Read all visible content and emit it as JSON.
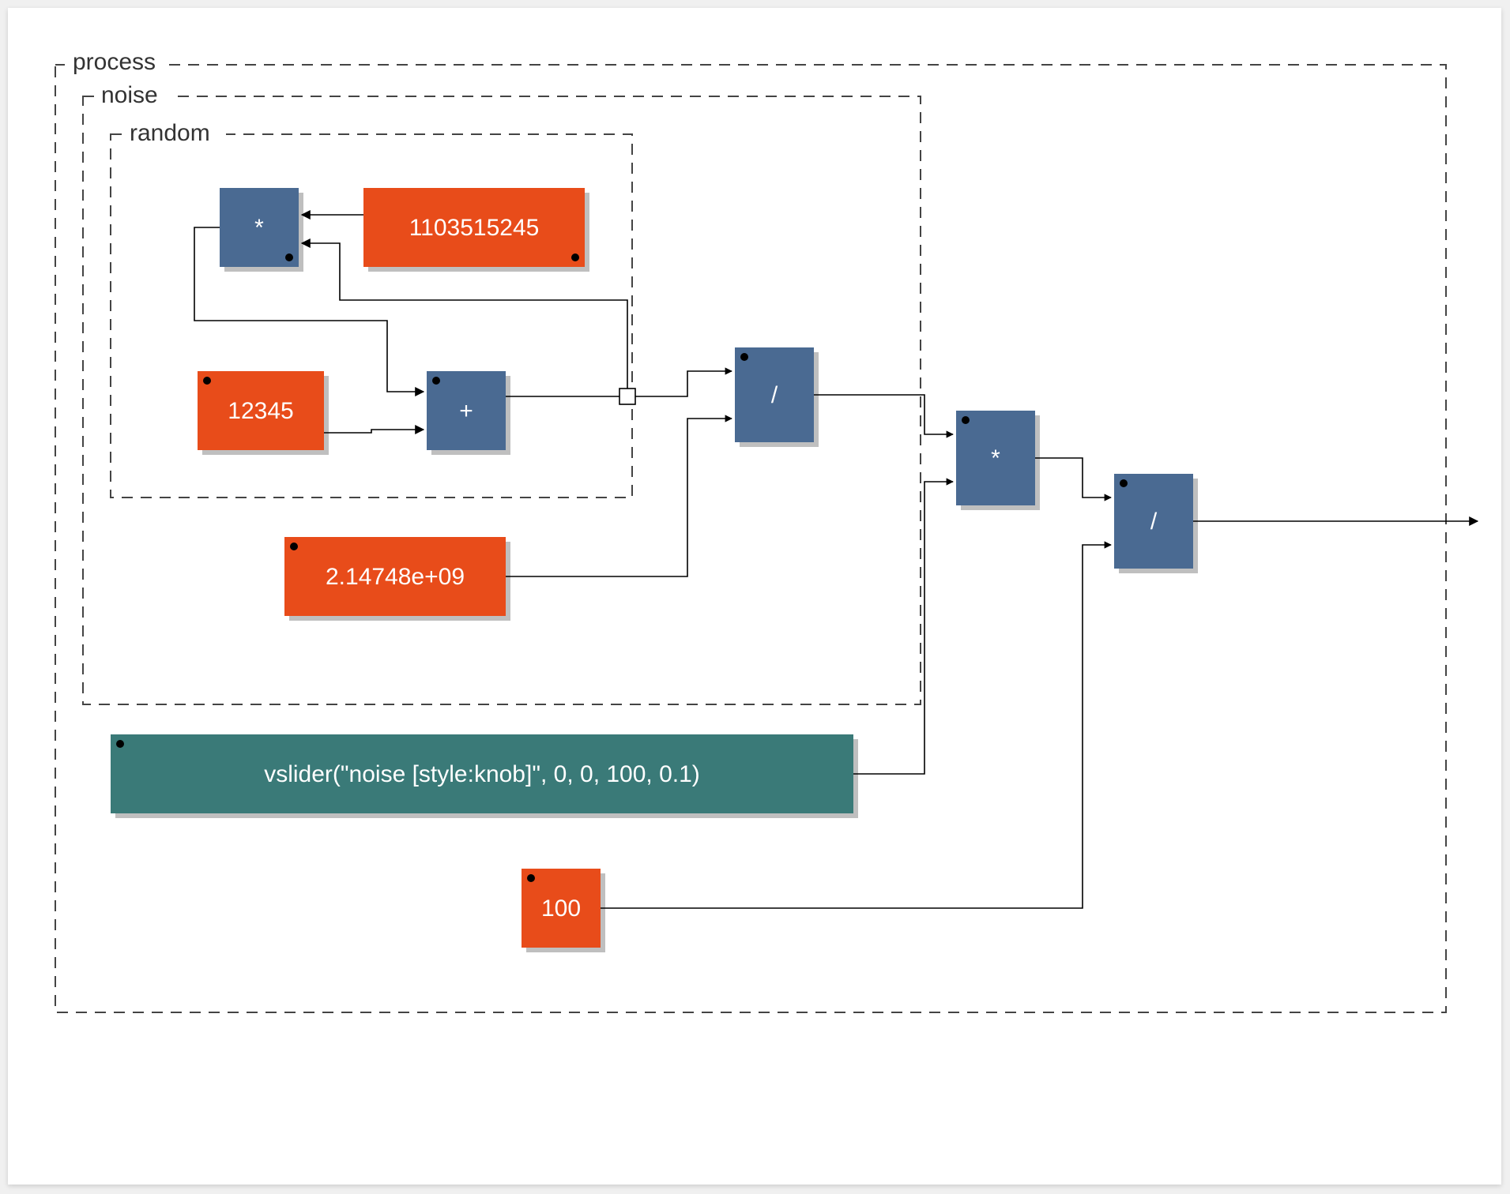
{
  "groups": {
    "process": "process",
    "noise": "noise",
    "random": "random"
  },
  "nodes": {
    "mul1": "*",
    "const1103515245": "1103515245",
    "const12345": "12345",
    "add": "+",
    "const214748e09": "2.14748e+09",
    "div1": "/",
    "mul2": "*",
    "div2": "/",
    "vslider": "vslider(\"noise [style:knob]\", 0, 0, 100, 0.1)",
    "const100": "100"
  }
}
